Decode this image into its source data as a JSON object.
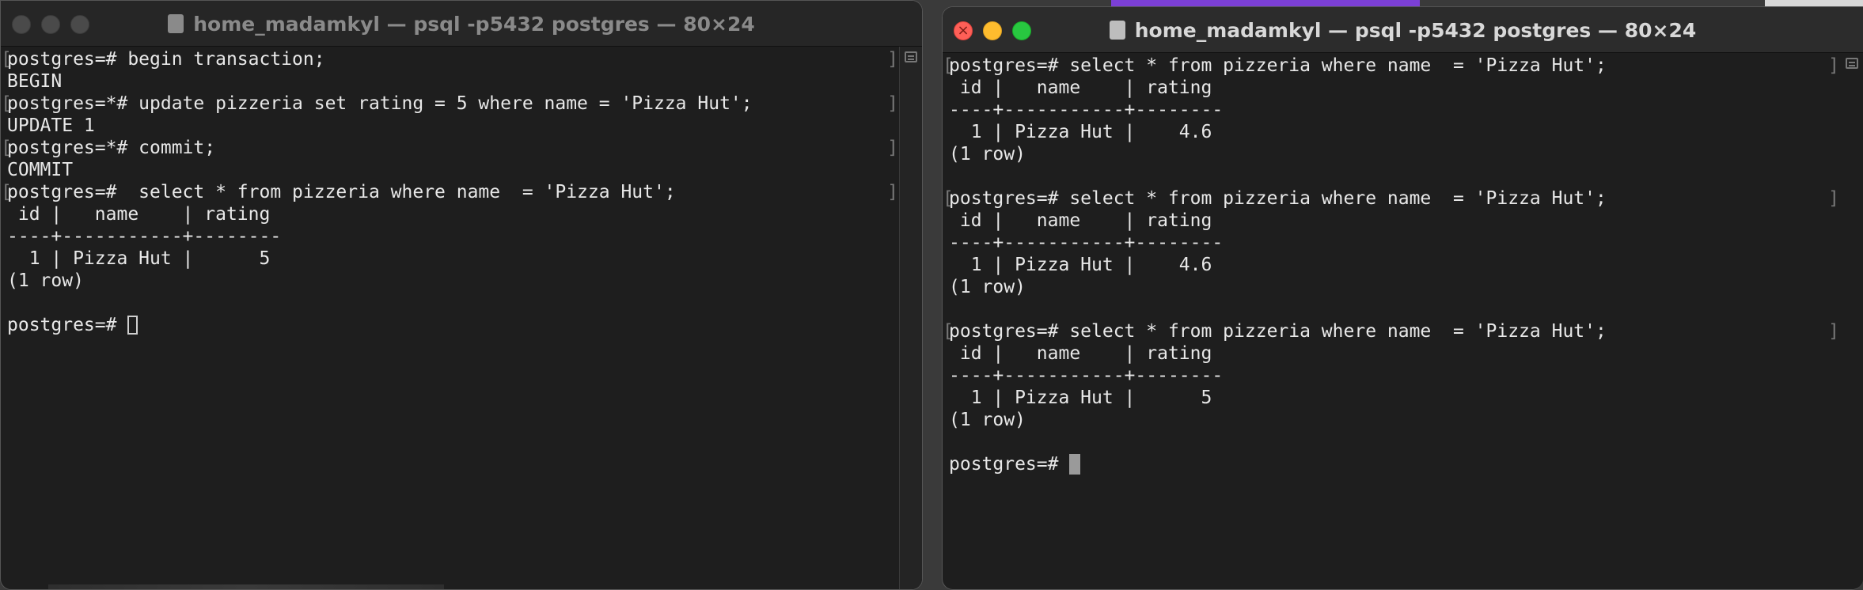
{
  "left_window": {
    "title": "home_madamkyl — psql -p5432 postgres — 80×24",
    "lines": [
      "postgres=# begin transaction;",
      "BEGIN",
      "postgres=*# update pizzeria set rating = 5 where name = 'Pizza Hut';",
      "UPDATE 1",
      "postgres=*# commit;",
      "COMMIT",
      "postgres=#  select * from pizzeria where name  = 'Pizza Hut';",
      " id |   name    | rating ",
      "----+-----------+--------",
      "  1 | Pizza Hut |      5",
      "(1 row)",
      "",
      "postgres=# "
    ]
  },
  "right_window": {
    "title": "home_madamkyl — psql -p5432 postgres — 80×24",
    "lines": [
      "postgres=# select * from pizzeria where name  = 'Pizza Hut';",
      " id |   name    | rating ",
      "----+-----------+--------",
      "  1 | Pizza Hut |    4.6",
      "(1 row)",
      "",
      "postgres=# select * from pizzeria where name  = 'Pizza Hut';",
      " id |   name    | rating ",
      "----+-----------+--------",
      "  1 | Pizza Hut |    4.6",
      "(1 row)",
      "",
      "postgres=# select * from pizzeria where name  = 'Pizza Hut';",
      " id |   name    | rating ",
      "----+-----------+--------",
      "  1 | Pizza Hut |      5",
      "(1 row)",
      "",
      "postgres=# "
    ]
  }
}
